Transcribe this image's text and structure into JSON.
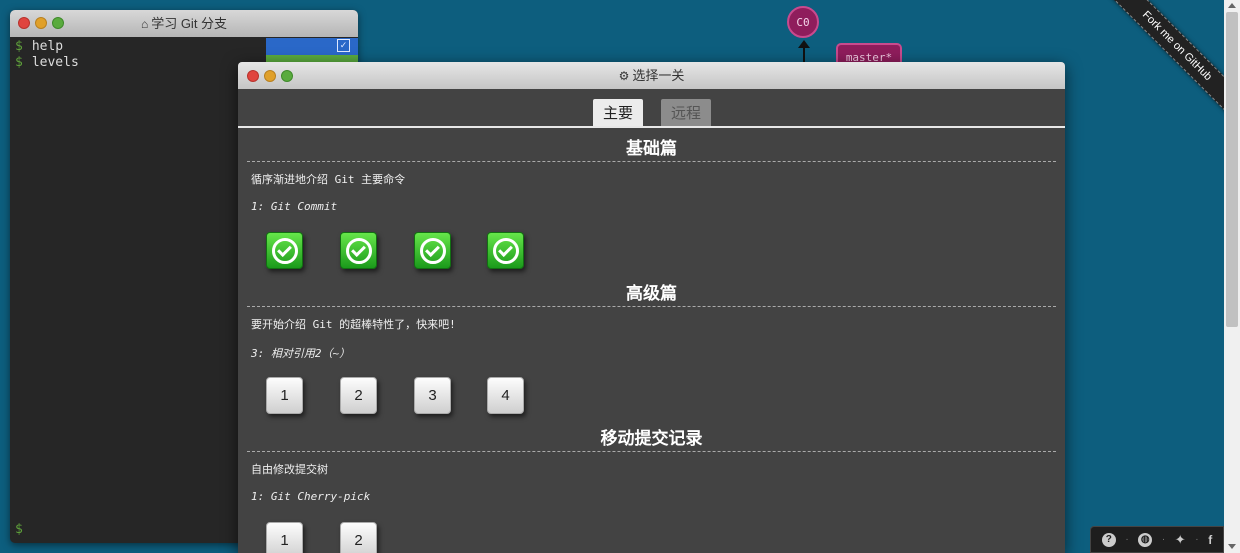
{
  "background": {
    "commit_node": "C0",
    "branch_label": "master*",
    "ribbon_text": "Fork me on GitHub"
  },
  "terminal": {
    "title": "学习 Git 分支",
    "lines": [
      {
        "prompt": "$",
        "command": "help"
      },
      {
        "prompt": "$",
        "command": "levels"
      }
    ],
    "bottom_prompt": "$"
  },
  "dialog": {
    "title": "选择一关",
    "tabs": [
      {
        "label": "主要",
        "active": true
      },
      {
        "label": "远程",
        "active": false
      }
    ],
    "sections": [
      {
        "title": "基础篇",
        "description": "循序渐进地介绍 Git 主要命令",
        "current_level": "1: Git Commit",
        "levels": [
          {
            "label": "",
            "completed": true
          },
          {
            "label": "",
            "completed": true
          },
          {
            "label": "",
            "completed": true
          },
          {
            "label": "",
            "completed": true
          }
        ]
      },
      {
        "title": "高级篇",
        "description": "要开始介绍 Git 的超棒特性了，快来吧!",
        "current_level": "3: 相对引用2（~）",
        "levels": [
          {
            "label": "1",
            "completed": false
          },
          {
            "label": "2",
            "completed": false
          },
          {
            "label": "3",
            "completed": false
          },
          {
            "label": "4",
            "completed": false
          }
        ]
      },
      {
        "title": "移动提交记录",
        "description": "自由修改提交树",
        "current_level": "1: Git Cherry-pick",
        "levels": [
          {
            "label": "1",
            "completed": false
          },
          {
            "label": "2",
            "completed": false
          }
        ]
      }
    ]
  },
  "bottom_bar": {
    "icons": [
      "help-icon",
      "globe-icon",
      "twitter-icon",
      "facebook-icon"
    ],
    "separator": "·",
    "help_glyph": "?",
    "facebook_glyph": "f"
  }
}
